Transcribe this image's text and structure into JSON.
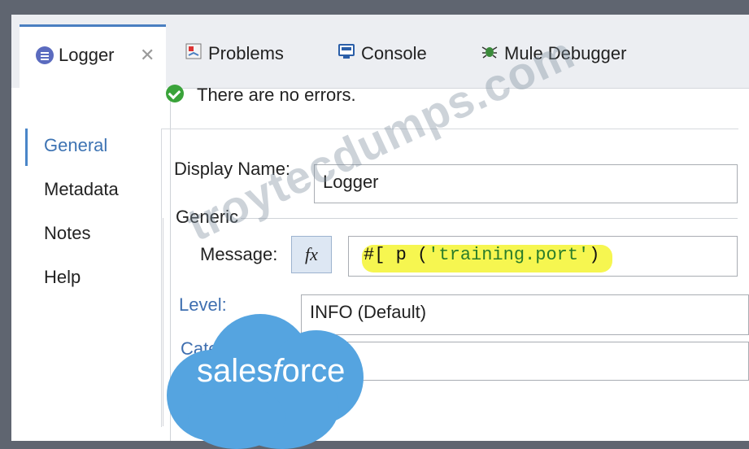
{
  "tabs": {
    "active": {
      "label": "Logger",
      "icon": "logger-icon"
    },
    "others": [
      {
        "label": "Problems",
        "icon": "problems-icon"
      },
      {
        "label": "Console",
        "icon": "console-icon"
      },
      {
        "label": "Mule Debugger",
        "icon": "debugger-bug-icon"
      }
    ]
  },
  "nav": {
    "items": [
      {
        "label": "General",
        "active": true
      },
      {
        "label": "Metadata",
        "active": false
      },
      {
        "label": "Notes",
        "active": false
      },
      {
        "label": "Help",
        "active": false
      }
    ]
  },
  "status": {
    "text": "There are no errors.",
    "icon": "check-circle-icon",
    "color": "#3aa33a"
  },
  "form": {
    "display_name_label": "Display Name:",
    "display_name_value": "Logger",
    "group_label": "Generic",
    "message_label": "Message:",
    "fx_label": "fx",
    "message_expr_open": "#[ p (",
    "message_expr_string": "'training.port'",
    "message_expr_close": ")",
    "level_label": "Level:",
    "level_value": "INFO (Default)",
    "category_label": "Category:",
    "category_value": ""
  },
  "watermark": {
    "text": "troytecdumps.com"
  },
  "logo": {
    "text_pre": "sales",
    "text_italic": "f",
    "text_post": "orce",
    "color": "#55a4e0"
  },
  "colors": {
    "accent": "#4a7fc1",
    "highlight": "#f5f53d",
    "window_bg": "#5f6570"
  }
}
